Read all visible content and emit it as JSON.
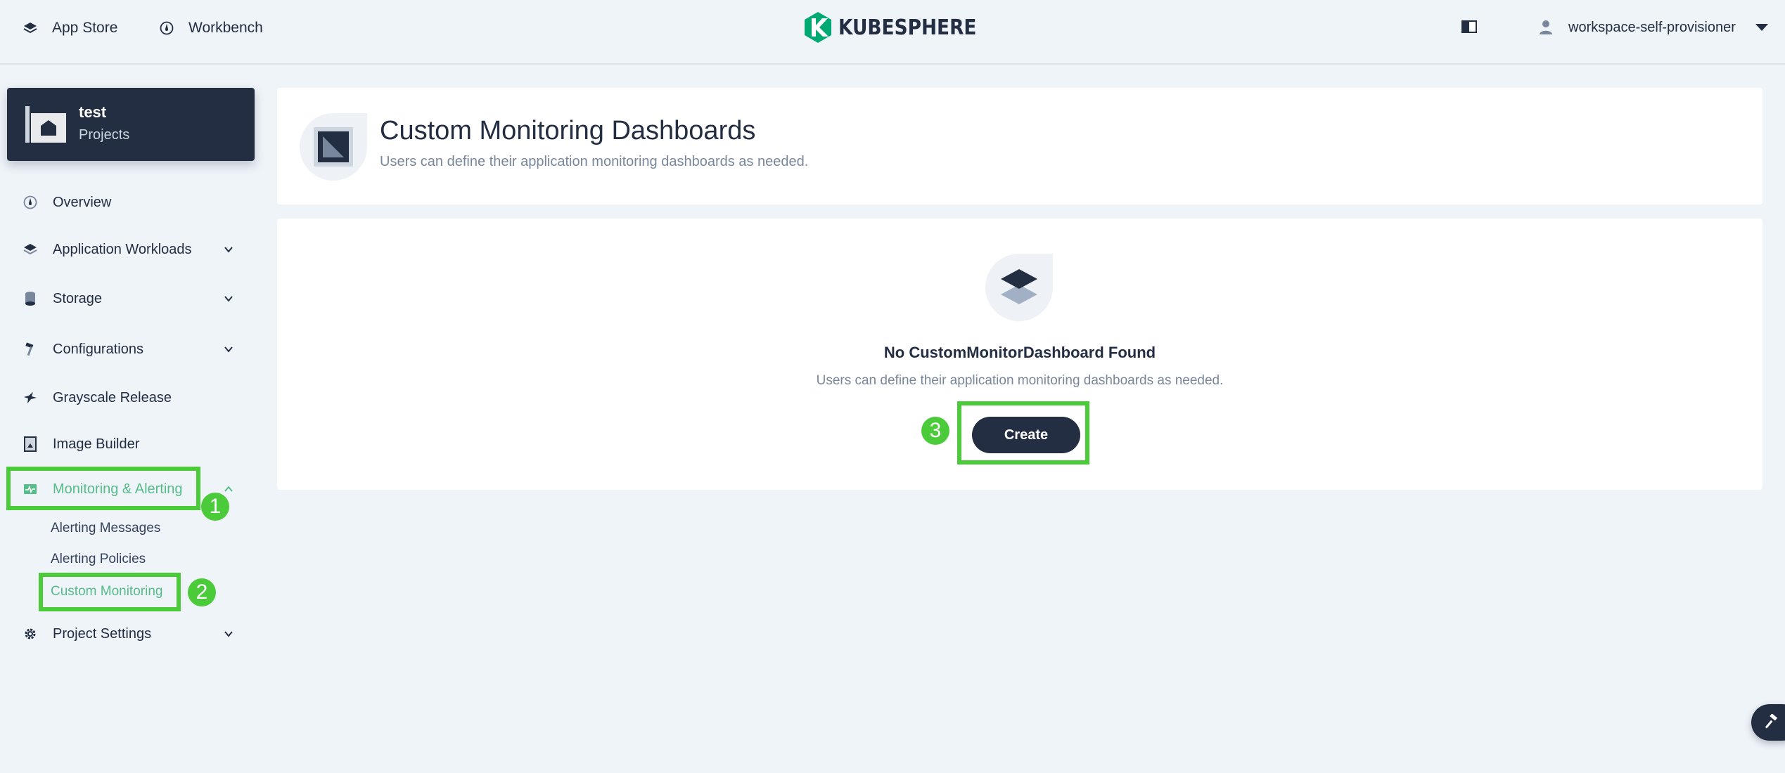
{
  "topbar": {
    "app_store_label": "App Store",
    "workbench_label": "Workbench",
    "logo_text": "KUBESPHERE",
    "username": "workspace-self-provisioner"
  },
  "project": {
    "name": "test",
    "type": "Projects"
  },
  "sidebar": {
    "items": [
      {
        "label": "Overview",
        "icon": "dashboard-icon"
      },
      {
        "label": "Application Workloads",
        "icon": "layers-icon"
      },
      {
        "label": "Storage",
        "icon": "database-icon"
      },
      {
        "label": "Configurations",
        "icon": "hammer-icon"
      },
      {
        "label": "Grayscale Release",
        "icon": "bird-icon"
      },
      {
        "label": "Image Builder",
        "icon": "image-builder-icon"
      },
      {
        "label": "Monitoring & Alerting",
        "icon": "monitor-icon"
      },
      {
        "label": "Project Settings",
        "icon": "gear-icon"
      }
    ],
    "monitoring_children": [
      {
        "label": "Alerting Messages"
      },
      {
        "label": "Alerting Policies"
      },
      {
        "label": "Custom Monitoring"
      }
    ]
  },
  "page": {
    "title": "Custom Monitoring Dashboards",
    "description": "Users can define their application monitoring dashboards as needed."
  },
  "empty_state": {
    "title": "No CustomMonitorDashboard Found",
    "description": "Users can define their application monitoring dashboards as needed.",
    "create_label": "Create"
  },
  "annotations": {
    "step1": "1",
    "step2": "2",
    "step3": "3"
  },
  "colors": {
    "accent": "#55bc8a",
    "dark": "#242e42",
    "highlight": "#4ccb3a",
    "background": "#eff4f9"
  }
}
